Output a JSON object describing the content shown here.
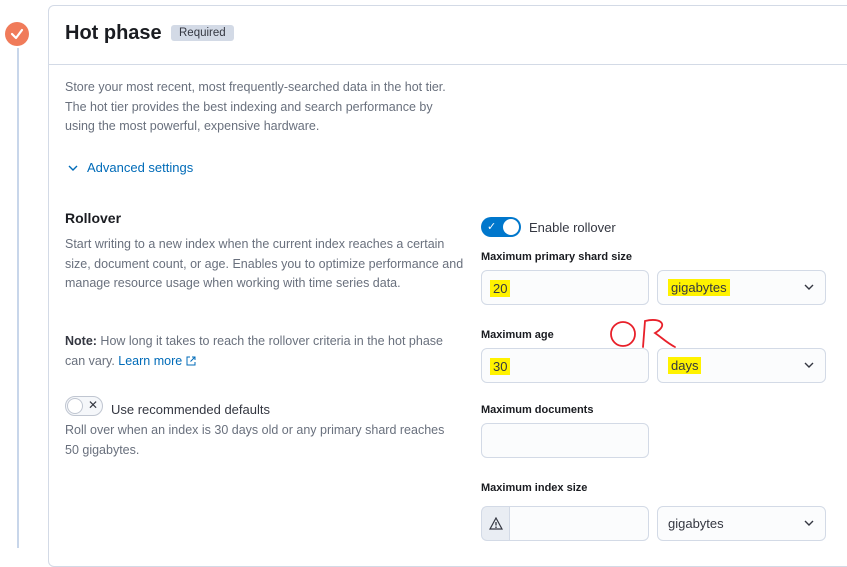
{
  "phase": {
    "title": "Hot phase",
    "badge": "Required",
    "description": "Store your most recent, most frequently-searched data in the hot tier. The hot tier provides the best indexing and search performance by using the most powerful, expensive hardware.",
    "advanced_settings_label": "Advanced settings"
  },
  "rollover": {
    "title": "Rollover",
    "description": "Start writing to a new index when the current index reaches a certain size, document count, or age. Enables you to optimize performance and manage resource usage when working with time series data.",
    "note_label": "Note:",
    "note_text": " How long it takes to reach the rollover criteria in the hot phase can vary. ",
    "learn_more": "Learn more",
    "use_recommended_label": "Use recommended defaults",
    "recommended_description": "Roll over when an index is 30 days old or any primary shard reaches 50 gigabytes.",
    "enable_label": "Enable rollover",
    "enabled": true,
    "use_recommended": false
  },
  "fields": {
    "max_shard_size": {
      "label": "Maximum primary shard size",
      "value": "20",
      "unit": "gigabytes"
    },
    "max_age": {
      "label": "Maximum age",
      "value": "30",
      "unit": "days"
    },
    "max_docs": {
      "label": "Maximum documents",
      "value": ""
    },
    "max_index_size": {
      "label": "Maximum index size",
      "value": "",
      "unit": "gigabytes"
    }
  },
  "annotation": {
    "text": "OR",
    "color": "#e8202a"
  },
  "colors": {
    "accent": "#006bb8",
    "toggle_on": "#0077cc",
    "timeline_dot": "#f07b5a",
    "highlight": "#fff200"
  }
}
